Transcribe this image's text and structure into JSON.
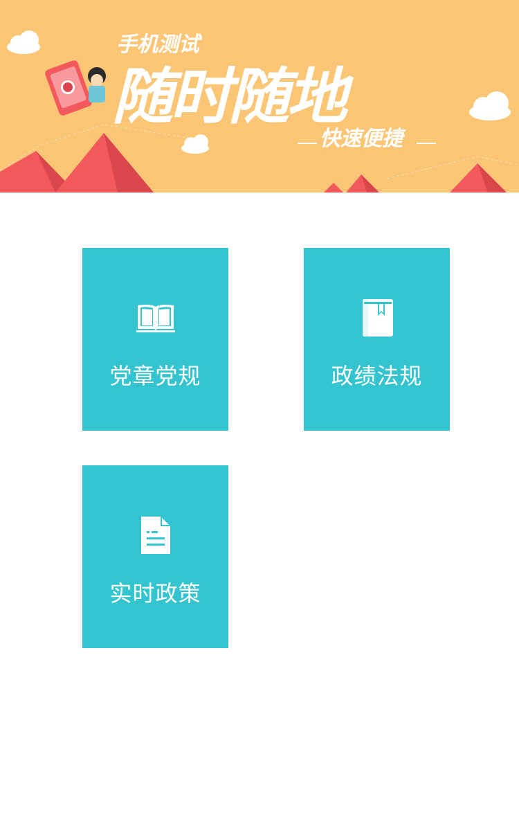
{
  "banner": {
    "kicker": "手机测试",
    "headline": "随时随地",
    "tagline": "快速便捷",
    "background_color": "#fbc576",
    "accent_color": "#f2585c"
  },
  "menu": {
    "tile_color": "#33c4cf",
    "items": [
      {
        "label": "党章党规",
        "icon": "open-book-icon"
      },
      {
        "label": "政绩法规",
        "icon": "bookmarked-book-icon"
      },
      {
        "label": "实时政策",
        "icon": "document-icon"
      }
    ]
  }
}
